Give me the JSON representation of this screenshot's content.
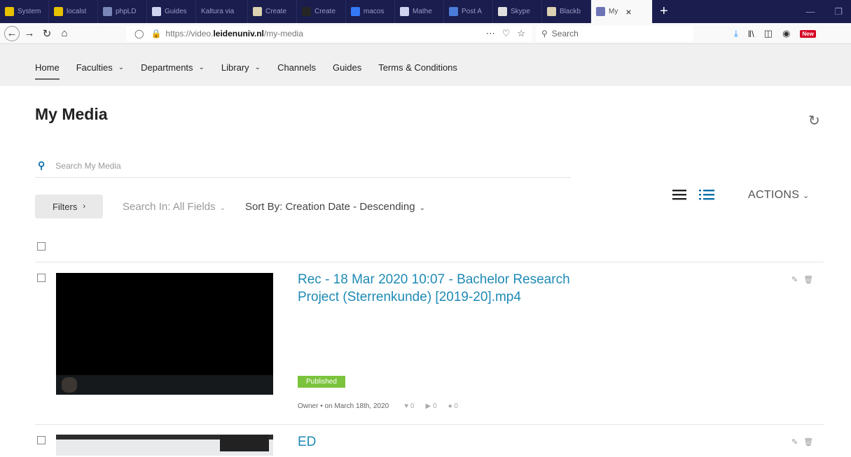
{
  "browser": {
    "tabs": [
      {
        "label": "System",
        "favicon_color": "#e5c100"
      },
      {
        "label": "localst",
        "favicon_color": "#e5c100"
      },
      {
        "label": "phpLD",
        "favicon_color": "#7a86b8"
      },
      {
        "label": "Guides",
        "favicon_color": "#cfd3ef"
      },
      {
        "label": "Kaltura via",
        "favicon_color": ""
      },
      {
        "label": "Create",
        "favicon_color": "#dcd2b2"
      },
      {
        "label": "Create",
        "favicon_color": "#262626"
      },
      {
        "label": "macos",
        "favicon_color": "#3478f6"
      },
      {
        "label": "Mathe",
        "favicon_color": "#cfd3ef"
      },
      {
        "label": "Post A",
        "favicon_color": "#4a7bd8"
      },
      {
        "label": "Skype",
        "favicon_color": "#e0e0e0"
      },
      {
        "label": "Blackb",
        "favicon_color": "#dcd2b2"
      },
      {
        "label": "My",
        "favicon_color": "#6d74b5",
        "active": true
      }
    ],
    "new_tab": "+",
    "url_prefix": "https://video.",
    "url_host": "leidenuniv.nl",
    "url_path": "/my-media",
    "search_placeholder": "Search",
    "new_badge": "New"
  },
  "sitenav": {
    "items": [
      {
        "label": "Home",
        "dropdown": false
      },
      {
        "label": "Faculties",
        "dropdown": true
      },
      {
        "label": "Departments",
        "dropdown": true
      },
      {
        "label": "Library",
        "dropdown": true
      },
      {
        "label": "Channels",
        "dropdown": false
      },
      {
        "label": "Guides",
        "dropdown": false
      },
      {
        "label": "Terms & Conditions",
        "dropdown": false
      }
    ]
  },
  "main": {
    "title": "My Media",
    "search_placeholder": "Search My Media",
    "filters_label": "Filters",
    "search_in": "Search In: All Fields",
    "sort_by": "Sort By: Creation Date - Descending",
    "actions_label": "ACTIONS"
  },
  "media": [
    {
      "title": "Rec - 18 Mar 2020 10:07 - Bachelor Research Project (Sterrenkunde) [2019-20].mp4",
      "status": "Published",
      "owner": "Owner",
      "date": "on March 18th, 2020",
      "likes": "0",
      "plays": "0",
      "comments": "0"
    },
    {
      "title": "ED"
    }
  ],
  "colors": {
    "link": "#1f8ab5",
    "published": "#7bc33c",
    "tabstrip": "#1a1d4e"
  }
}
